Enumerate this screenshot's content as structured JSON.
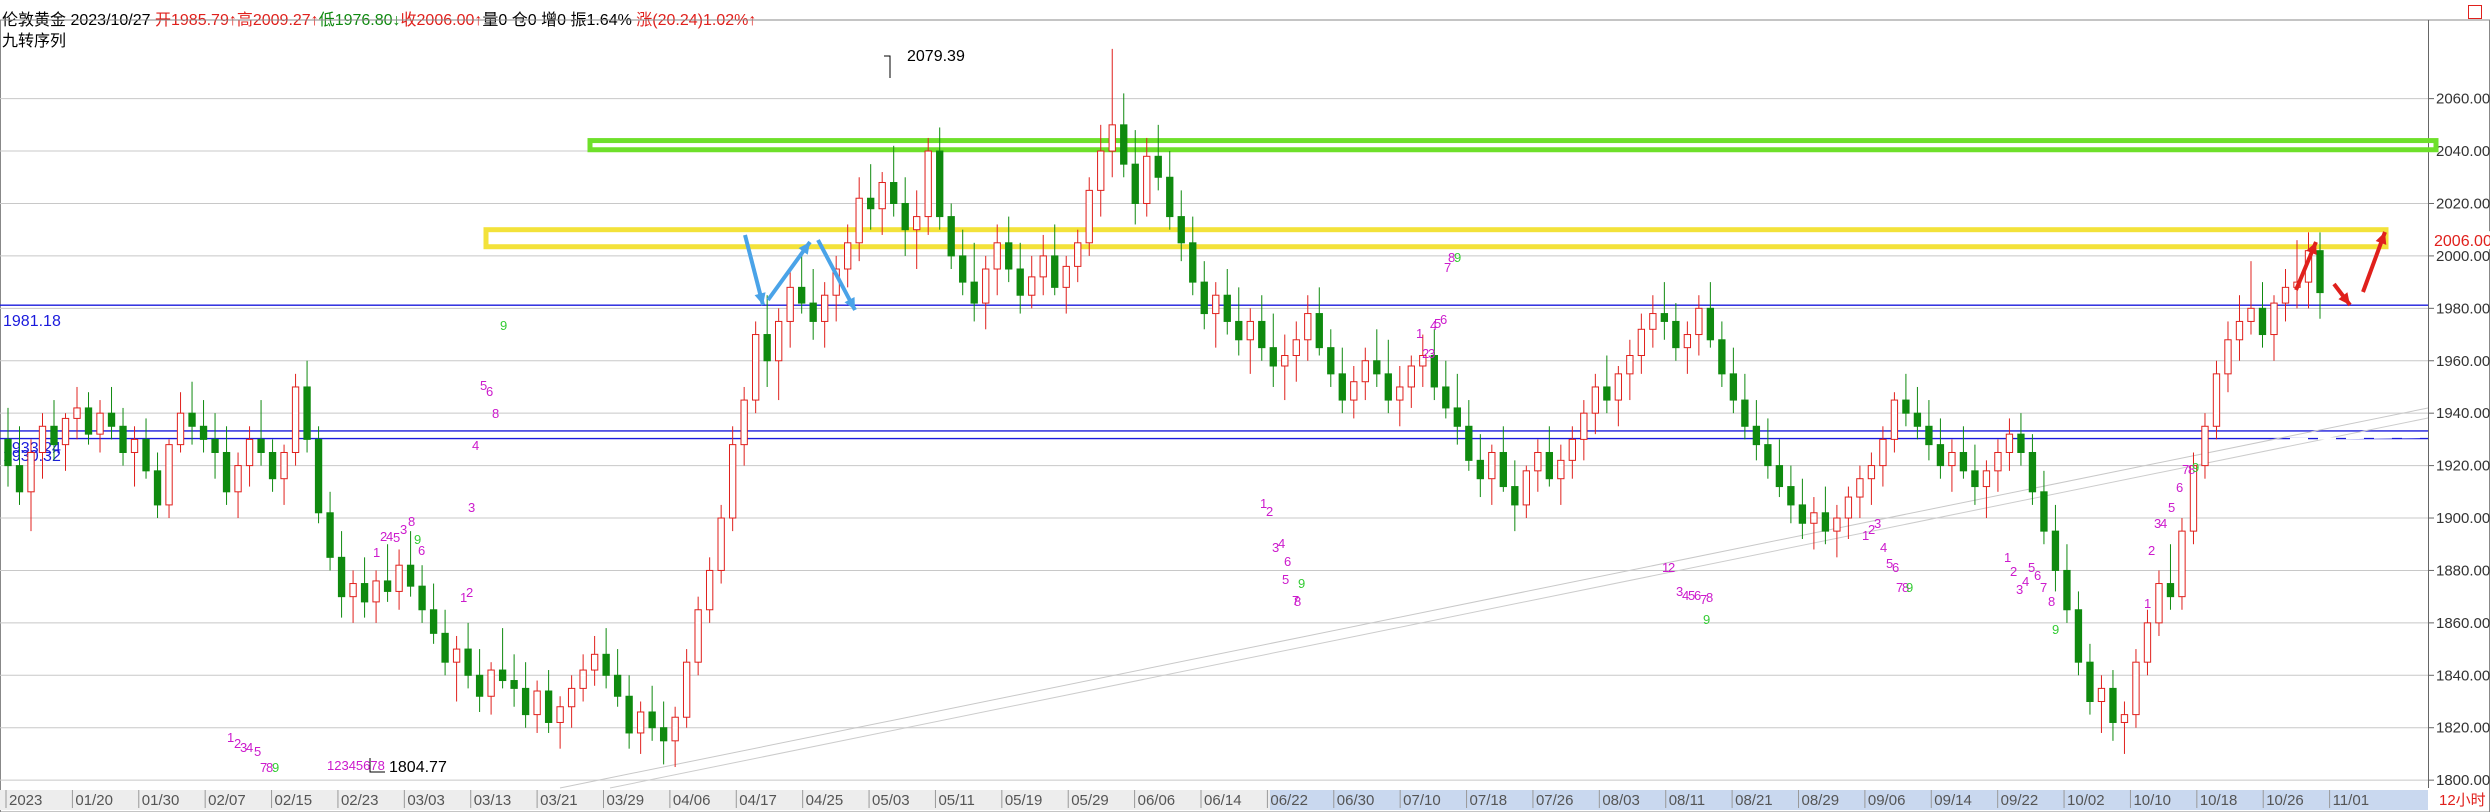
{
  "header": {
    "symbol": "伦敦黄金",
    "date": "2023/10/27",
    "open": "开1985.79↑",
    "high": "高2009.27↑",
    "low": "低1976.80↓",
    "close": "收2006.00↑",
    "volume": "量0",
    "position": "仓0",
    "increase": "增0",
    "amplitude": "振1.64%",
    "change": "涨(20.24)1.02%↑",
    "indicator": "九转序列"
  },
  "levels": {
    "upper": "1981.18",
    "mid1": "1933.24",
    "mid2": "1930.32"
  },
  "colors": {
    "up": "#e0201c",
    "down": "#0f8a0f",
    "grid": "#c8c8c8",
    "zone_green": "#6ee02a",
    "zone_yellow": "#f3e23a",
    "arrow_blue": "#4aa3e8",
    "arrow_red": "#e0201c",
    "counter_magenta": "#cc1acc",
    "counter_green": "#33cc33",
    "hline_blue": "#1a1adc"
  },
  "chart_data": {
    "type": "candlestick",
    "title": "伦敦黄金",
    "ylim": [
      1797,
      2090
    ],
    "y_ticks": [
      1800,
      1820,
      1840,
      1860,
      1880,
      1900,
      1920,
      1940,
      1960,
      1980,
      2000,
      2020,
      2040,
      2060
    ],
    "x_tick_labels": [
      "2023",
      "01/20",
      "01/30",
      "02/07",
      "02/15",
      "02/23",
      "03/03",
      "03/13",
      "03/21",
      "03/29",
      "04/06",
      "04/17",
      "04/25",
      "05/03",
      "05/11",
      "05/19",
      "05/29",
      "06/06",
      "06/14",
      "06/22",
      "06/30",
      "07/10",
      "07/18",
      "07/26",
      "08/03",
      "08/11",
      "08/21",
      "08/29",
      "09/06",
      "09/14",
      "09/22",
      "10/02",
      "10/10",
      "10/18",
      "10/26",
      "11/01",
      "12小时"
    ],
    "current_price": "2006.00",
    "annotations": [
      {
        "label": "2079.39"
      },
      {
        "label": "1804.77"
      }
    ],
    "horizontal_lines": [
      1981.18,
      1933.24,
      1930.32
    ],
    "zones": [
      {
        "name": "green-resistance",
        "y0": 2040.5,
        "y1": 2044.0
      },
      {
        "name": "yellow-resistance",
        "y0": 2003.5,
        "y1": 2010.0
      }
    ],
    "ohlc": [
      [
        1930,
        1942,
        1912,
        1920
      ],
      [
        1920,
        1935,
        1905,
        1910
      ],
      [
        1910,
        1930,
        1895,
        1925
      ],
      [
        1925,
        1940,
        1915,
        1935
      ],
      [
        1935,
        1945,
        1922,
        1928
      ],
      [
        1928,
        1940,
        1918,
        1938
      ],
      [
        1938,
        1950,
        1930,
        1942
      ],
      [
        1942,
        1948,
        1928,
        1932
      ],
      [
        1932,
        1945,
        1925,
        1940
      ],
      [
        1940,
        1950,
        1930,
        1935
      ],
      [
        1935,
        1942,
        1920,
        1925
      ],
      [
        1925,
        1935,
        1912,
        1930
      ],
      [
        1930,
        1938,
        1915,
        1918
      ],
      [
        1918,
        1925,
        1900,
        1905
      ],
      [
        1905,
        1930,
        1900,
        1928
      ],
      [
        1928,
        1948,
        1925,
        1940
      ],
      [
        1940,
        1952,
        1928,
        1935
      ],
      [
        1935,
        1945,
        1925,
        1930
      ],
      [
        1930,
        1940,
        1915,
        1925
      ],
      [
        1925,
        1935,
        1905,
        1910
      ],
      [
        1910,
        1925,
        1900,
        1920
      ],
      [
        1920,
        1935,
        1912,
        1930
      ],
      [
        1930,
        1945,
        1920,
        1925
      ],
      [
        1925,
        1930,
        1910,
        1915
      ],
      [
        1915,
        1928,
        1905,
        1925
      ],
      [
        1925,
        1955,
        1920,
        1950
      ],
      [
        1950,
        1960,
        1925,
        1930
      ],
      [
        1930,
        1935,
        1898,
        1902
      ],
      [
        1902,
        1910,
        1880,
        1885
      ],
      [
        1885,
        1895,
        1862,
        1870
      ],
      [
        1870,
        1880,
        1860,
        1875
      ],
      [
        1875,
        1885,
        1862,
        1868
      ],
      [
        1868,
        1880,
        1860,
        1876
      ],
      [
        1876,
        1890,
        1868,
        1872
      ],
      [
        1872,
        1888,
        1865,
        1882
      ],
      [
        1882,
        1895,
        1870,
        1874
      ],
      [
        1874,
        1882,
        1860,
        1865
      ],
      [
        1865,
        1875,
        1852,
        1856
      ],
      [
        1856,
        1865,
        1840,
        1845
      ],
      [
        1845,
        1855,
        1830,
        1850
      ],
      [
        1850,
        1860,
        1835,
        1840
      ],
      [
        1840,
        1850,
        1826,
        1832
      ],
      [
        1832,
        1845,
        1825,
        1842
      ],
      [
        1842,
        1858,
        1835,
        1838
      ],
      [
        1838,
        1848,
        1828,
        1835
      ],
      [
        1835,
        1845,
        1820,
        1825
      ],
      [
        1825,
        1838,
        1818,
        1834
      ],
      [
        1834,
        1842,
        1818,
        1822
      ],
      [
        1822,
        1832,
        1812,
        1828
      ],
      [
        1828,
        1840,
        1820,
        1835
      ],
      [
        1835,
        1848,
        1830,
        1842
      ],
      [
        1842,
        1855,
        1836,
        1848
      ],
      [
        1848,
        1858,
        1835,
        1840
      ],
      [
        1840,
        1850,
        1828,
        1832
      ],
      [
        1832,
        1840,
        1812,
        1818
      ],
      [
        1818,
        1830,
        1810,
        1826
      ],
      [
        1826,
        1836,
        1815,
        1820
      ],
      [
        1820,
        1830,
        1806,
        1815
      ],
      [
        1815,
        1828,
        1805,
        1824
      ],
      [
        1824,
        1850,
        1820,
        1845
      ],
      [
        1845,
        1870,
        1840,
        1865
      ],
      [
        1865,
        1885,
        1860,
        1880
      ],
      [
        1880,
        1905,
        1875,
        1900
      ],
      [
        1900,
        1935,
        1895,
        1928
      ],
      [
        1928,
        1950,
        1920,
        1945
      ],
      [
        1945,
        1975,
        1940,
        1970
      ],
      [
        1970,
        1985,
        1950,
        1960
      ],
      [
        1960,
        1980,
        1945,
        1975
      ],
      [
        1975,
        1995,
        1965,
        1988
      ],
      [
        1988,
        2002,
        1978,
        1982
      ],
      [
        1982,
        1995,
        1968,
        1975
      ],
      [
        1975,
        1990,
        1965,
        1985
      ],
      [
        1985,
        2000,
        1975,
        1995
      ],
      [
        1995,
        2012,
        1988,
        2005
      ],
      [
        2005,
        2030,
        1998,
        2022
      ],
      [
        2022,
        2035,
        2010,
        2018
      ],
      [
        2018,
        2032,
        2008,
        2028
      ],
      [
        2028,
        2042,
        2015,
        2020
      ],
      [
        2020,
        2030,
        2000,
        2010
      ],
      [
        2010,
        2025,
        1995,
        2015
      ],
      [
        2015,
        2045,
        2008,
        2040
      ],
      [
        2040,
        2049,
        2010,
        2015
      ],
      [
        2015,
        2020,
        1995,
        2000
      ],
      [
        2000,
        2010,
        1985,
        1990
      ],
      [
        1990,
        2005,
        1975,
        1982
      ],
      [
        1982,
        2000,
        1972,
        1995
      ],
      [
        1995,
        2012,
        1985,
        2005
      ],
      [
        2005,
        2015,
        1990,
        1995
      ],
      [
        1995,
        2005,
        1978,
        1985
      ],
      [
        1985,
        2000,
        1980,
        1992
      ],
      [
        1992,
        2008,
        1985,
        2000
      ],
      [
        2000,
        2012,
        1985,
        1988
      ],
      [
        1988,
        2000,
        1978,
        1996
      ],
      [
        1996,
        2010,
        1990,
        2005
      ],
      [
        2005,
        2030,
        2000,
        2025
      ],
      [
        2025,
        2050,
        2015,
        2040
      ],
      [
        2040,
        2079,
        2030,
        2050
      ],
      [
        2050,
        2062,
        2030,
        2035
      ],
      [
        2035,
        2048,
        2012,
        2020
      ],
      [
        2020,
        2045,
        2015,
        2038
      ],
      [
        2038,
        2050,
        2025,
        2030
      ],
      [
        2030,
        2040,
        2010,
        2015
      ],
      [
        2015,
        2025,
        1998,
        2005
      ],
      [
        2005,
        2015,
        1985,
        1990
      ],
      [
        1990,
        1998,
        1972,
        1978
      ],
      [
        1978,
        1990,
        1965,
        1985
      ],
      [
        1985,
        1995,
        1970,
        1975
      ],
      [
        1975,
        1988,
        1962,
        1968
      ],
      [
        1968,
        1980,
        1955,
        1975
      ],
      [
        1975,
        1985,
        1960,
        1965
      ],
      [
        1965,
        1978,
        1950,
        1958
      ],
      [
        1958,
        1970,
        1945,
        1962
      ],
      [
        1962,
        1975,
        1952,
        1968
      ],
      [
        1968,
        1985,
        1960,
        1978
      ],
      [
        1978,
        1988,
        1962,
        1965
      ],
      [
        1965,
        1972,
        1950,
        1955
      ],
      [
        1955,
        1965,
        1940,
        1945
      ],
      [
        1945,
        1958,
        1938,
        1952
      ],
      [
        1952,
        1965,
        1945,
        1960
      ],
      [
        1960,
        1972,
        1950,
        1955
      ],
      [
        1955,
        1968,
        1940,
        1945
      ],
      [
        1945,
        1958,
        1935,
        1950
      ],
      [
        1950,
        1962,
        1942,
        1958
      ],
      [
        1958,
        1970,
        1950,
        1962
      ],
      [
        1962,
        1972,
        1945,
        1950
      ],
      [
        1950,
        1960,
        1938,
        1942
      ],
      [
        1942,
        1955,
        1928,
        1935
      ],
      [
        1935,
        1945,
        1918,
        1922
      ],
      [
        1922,
        1932,
        1908,
        1915
      ],
      [
        1915,
        1928,
        1905,
        1925
      ],
      [
        1925,
        1935,
        1910,
        1912
      ],
      [
        1912,
        1922,
        1895,
        1905
      ],
      [
        1905,
        1920,
        1900,
        1918
      ],
      [
        1918,
        1930,
        1910,
        1925
      ],
      [
        1925,
        1935,
        1912,
        1915
      ],
      [
        1915,
        1928,
        1905,
        1922
      ],
      [
        1922,
        1935,
        1915,
        1930
      ],
      [
        1930,
        1945,
        1922,
        1940
      ],
      [
        1940,
        1955,
        1932,
        1950
      ],
      [
        1950,
        1962,
        1940,
        1945
      ],
      [
        1945,
        1958,
        1935,
        1955
      ],
      [
        1955,
        1968,
        1945,
        1962
      ],
      [
        1962,
        1978,
        1955,
        1972
      ],
      [
        1972,
        1985,
        1965,
        1978
      ],
      [
        1978,
        1990,
        1968,
        1975
      ],
      [
        1975,
        1982,
        1960,
        1965
      ],
      [
        1965,
        1975,
        1955,
        1970
      ],
      [
        1970,
        1985,
        1962,
        1980
      ],
      [
        1980,
        1990,
        1965,
        1968
      ],
      [
        1968,
        1975,
        1950,
        1955
      ],
      [
        1955,
        1965,
        1940,
        1945
      ],
      [
        1945,
        1955,
        1930,
        1935
      ],
      [
        1935,
        1945,
        1922,
        1928
      ],
      [
        1928,
        1938,
        1915,
        1920
      ],
      [
        1920,
        1930,
        1908,
        1912
      ],
      [
        1912,
        1920,
        1898,
        1905
      ],
      [
        1905,
        1915,
        1892,
        1898
      ],
      [
        1898,
        1908,
        1888,
        1902
      ],
      [
        1902,
        1912,
        1890,
        1895
      ],
      [
        1895,
        1905,
        1885,
        1900
      ],
      [
        1900,
        1912,
        1892,
        1908
      ],
      [
        1908,
        1920,
        1900,
        1915
      ],
      [
        1915,
        1925,
        1905,
        1920
      ],
      [
        1920,
        1935,
        1912,
        1930
      ],
      [
        1930,
        1948,
        1925,
        1945
      ],
      [
        1945,
        1955,
        1935,
        1940
      ],
      [
        1940,
        1950,
        1930,
        1935
      ],
      [
        1935,
        1945,
        1922,
        1928
      ],
      [
        1928,
        1938,
        1915,
        1920
      ],
      [
        1920,
        1930,
        1910,
        1925
      ],
      [
        1925,
        1935,
        1915,
        1918
      ],
      [
        1918,
        1928,
        1905,
        1912
      ],
      [
        1912,
        1922,
        1900,
        1918
      ],
      [
        1918,
        1930,
        1910,
        1925
      ],
      [
        1925,
        1938,
        1918,
        1932
      ],
      [
        1932,
        1940,
        1920,
        1925
      ],
      [
        1925,
        1932,
        1905,
        1910
      ],
      [
        1910,
        1918,
        1890,
        1895
      ],
      [
        1895,
        1905,
        1872,
        1880
      ],
      [
        1880,
        1890,
        1860,
        1865
      ],
      [
        1865,
        1872,
        1840,
        1845
      ],
      [
        1845,
        1852,
        1825,
        1830
      ],
      [
        1830,
        1840,
        1818,
        1835
      ],
      [
        1835,
        1842,
        1815,
        1822
      ],
      [
        1822,
        1830,
        1810,
        1825
      ],
      [
        1825,
        1850,
        1820,
        1845
      ],
      [
        1845,
        1865,
        1840,
        1860
      ],
      [
        1860,
        1880,
        1855,
        1875
      ],
      [
        1875,
        1890,
        1865,
        1870
      ],
      [
        1870,
        1900,
        1865,
        1895
      ],
      [
        1895,
        1925,
        1890,
        1920
      ],
      [
        1920,
        1940,
        1915,
        1935
      ],
      [
        1935,
        1960,
        1930,
        1955
      ],
      [
        1955,
        1975,
        1948,
        1968
      ],
      [
        1968,
        1985,
        1960,
        1975
      ],
      [
        1975,
        1998,
        1970,
        1980
      ],
      [
        1980,
        1990,
        1965,
        1970
      ],
      [
        1970,
        1985,
        1960,
        1982
      ],
      [
        1982,
        1995,
        1975,
        1988
      ],
      [
        1988,
        2006,
        1980,
        1990
      ],
      [
        1990,
        2009,
        1980,
        2002
      ],
      [
        2002,
        2009,
        1976,
        1986
      ]
    ]
  },
  "td_sequence_labels": [
    "1",
    "2",
    "3",
    "4",
    "5",
    "6",
    "7",
    "8",
    "9",
    "12345678"
  ]
}
